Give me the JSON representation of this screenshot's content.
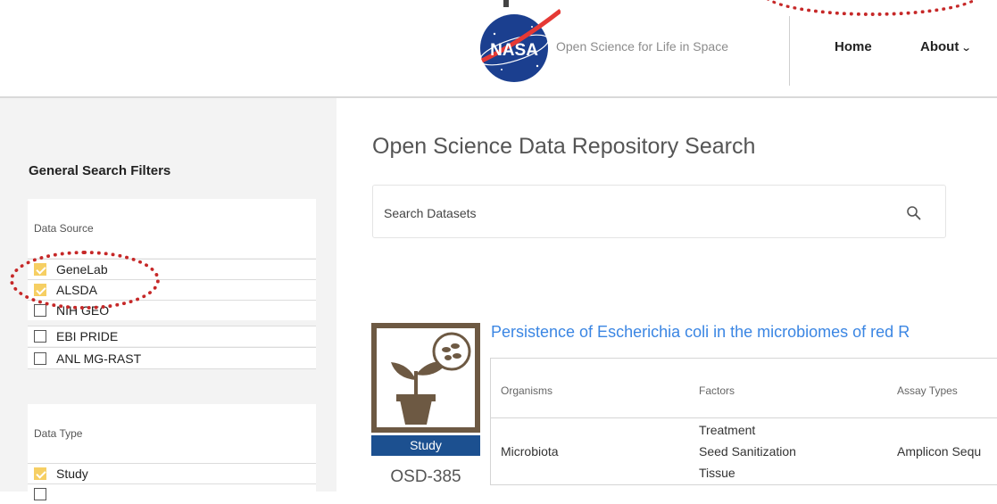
{
  "header": {
    "logo_text": "NASA",
    "tagline": "Open Science for Life in Space",
    "nav": {
      "home": "Home",
      "about": "About"
    }
  },
  "sidebar": {
    "title": "General Search Filters",
    "data_source": {
      "title": "Data Source",
      "options": [
        {
          "label": "GeneLab",
          "checked": true
        },
        {
          "label": "ALSDA",
          "checked": true
        },
        {
          "label": "NIH GEO",
          "checked": false
        },
        {
          "label": "EBI PRIDE",
          "checked": false
        },
        {
          "label": "ANL MG-RAST",
          "checked": false
        }
      ]
    },
    "data_type": {
      "title": "Data Type",
      "options": [
        {
          "label": "Study",
          "checked": true
        }
      ]
    }
  },
  "main": {
    "title": "Open Science Data Repository Search",
    "search": {
      "placeholder": "Search Datasets",
      "value": ""
    },
    "result": {
      "title": "Persistence of Escherichia coli in the microbiomes of red R",
      "badge": "Study",
      "id": "OSD-385",
      "columns": [
        "Organisms",
        "Factors",
        "Assay Types"
      ],
      "organisms": "Microbiota",
      "factors": [
        "Treatment",
        "Seed Sanitization",
        "Tissue"
      ],
      "assay_types": "Amplicon Sequ"
    }
  },
  "colors": {
    "accent_link": "#3b86e3",
    "checkbox_checked": "#f6cf63",
    "badge": "#1c5090",
    "annotation": "#c62828",
    "sidebar_bg": "#f3f3f3"
  }
}
